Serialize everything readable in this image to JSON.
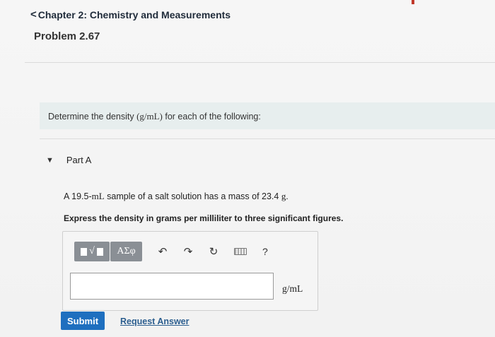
{
  "header": {
    "breadcrumb_chevron": "<",
    "breadcrumb_label": "Chapter 2: Chemistry and Measurements",
    "problem_title": "Problem 2.67"
  },
  "instruction": {
    "text_before": "Determine the density ",
    "math": "(g/mL)",
    "text_after": " for each of the following:"
  },
  "part": {
    "caret": "▼",
    "label": "Part A",
    "problem_text_before": "A 19.5-",
    "problem_unit_1": "mL",
    "problem_text_middle": " sample of a salt solution has a mass of 23.4 ",
    "problem_unit_2": "g.",
    "express": "Express the density in grams per milliliter to three significant figures."
  },
  "toolbar": {
    "templates_label": "√",
    "greek_label": "ΑΣφ",
    "undo_glyph": "↶",
    "redo_glyph": "↷",
    "reset_glyph": "↻",
    "help_label": "?"
  },
  "answer": {
    "value": "",
    "unit": "g/mL"
  },
  "actions": {
    "submit_label": "Submit",
    "request_label": "Request Answer"
  },
  "colors": {
    "submit_bg": "#1e6fbf",
    "instruction_bg": "#e7eeee",
    "toolbar_btn": "#8a8f95"
  }
}
